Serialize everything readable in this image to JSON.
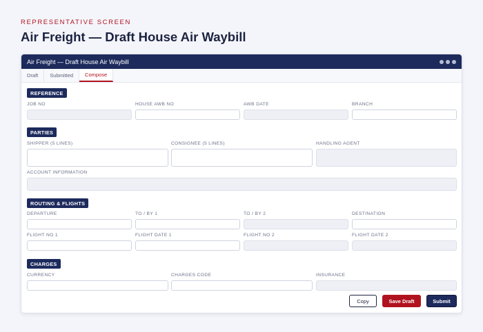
{
  "page": {
    "eyebrow": "REPRESENTATIVE SCREEN",
    "title": "Air Freight — Draft House Air Waybill"
  },
  "window": {
    "title": "Air Freight — Draft House Air Waybill"
  },
  "tabs": [
    {
      "label": "Draft",
      "active": false
    },
    {
      "label": "Submitted",
      "active": false
    },
    {
      "label": "Compose",
      "active": true
    }
  ],
  "sections": {
    "reference": {
      "label": "REFERENCE",
      "fields": {
        "job_no": {
          "label": "JOB NO",
          "value": "",
          "readonly": true
        },
        "house_awb_no": {
          "label": "HOUSE AWB NO",
          "value": "",
          "readonly": false
        },
        "awb_date": {
          "label": "AWB DATE",
          "value": "",
          "readonly": true
        },
        "branch": {
          "label": "BRANCH",
          "value": "",
          "readonly": false
        }
      }
    },
    "parties": {
      "label": "PARTIES",
      "fields": {
        "shipper": {
          "label": "SHIPPER (5 LINES)",
          "value": "",
          "readonly": false
        },
        "consignee": {
          "label": "CONSIGNEE (5 LINES)",
          "value": "",
          "readonly": false
        },
        "handling_agent": {
          "label": "HANDLING AGENT",
          "value": "",
          "readonly": true
        },
        "account_information": {
          "label": "ACCOUNT INFORMATION",
          "value": "",
          "readonly": true
        }
      }
    },
    "routing": {
      "label": "ROUTING & FLIGHTS",
      "fields": {
        "departure": {
          "label": "DEPARTURE",
          "value": "",
          "readonly": false
        },
        "to_by_1": {
          "label": "TO / BY 1",
          "value": "",
          "readonly": false
        },
        "to_by_2": {
          "label": "TO / BY 2",
          "value": "",
          "readonly": true
        },
        "destination": {
          "label": "DESTINATION",
          "value": "",
          "readonly": false
        },
        "flight_no_1": {
          "label": "FLIGHT NO 1",
          "value": "",
          "readonly": false
        },
        "flight_date_1": {
          "label": "FLIGHT DATE 1",
          "value": "",
          "readonly": false
        },
        "flight_no_2": {
          "label": "FLIGHT NO 2",
          "value": "",
          "readonly": true
        },
        "flight_date_2": {
          "label": "FLIGHT DATE 2",
          "value": "",
          "readonly": true
        }
      }
    },
    "charges": {
      "label": "CHARGES",
      "fields": {
        "currency": {
          "label": "CURRENCY",
          "value": "",
          "readonly": false
        },
        "charges_code": {
          "label": "CHARGES CODE",
          "value": "",
          "readonly": false
        },
        "insurance": {
          "label": "INSURANCE",
          "value": "",
          "readonly": true
        }
      }
    }
  },
  "actions": {
    "copy": "Copy",
    "save_draft": "Save Draft",
    "submit": "Submit"
  },
  "colors": {
    "accent": "#b1121f",
    "navy": "#1c2a5c",
    "readonly_bg": "#eef0f6"
  }
}
